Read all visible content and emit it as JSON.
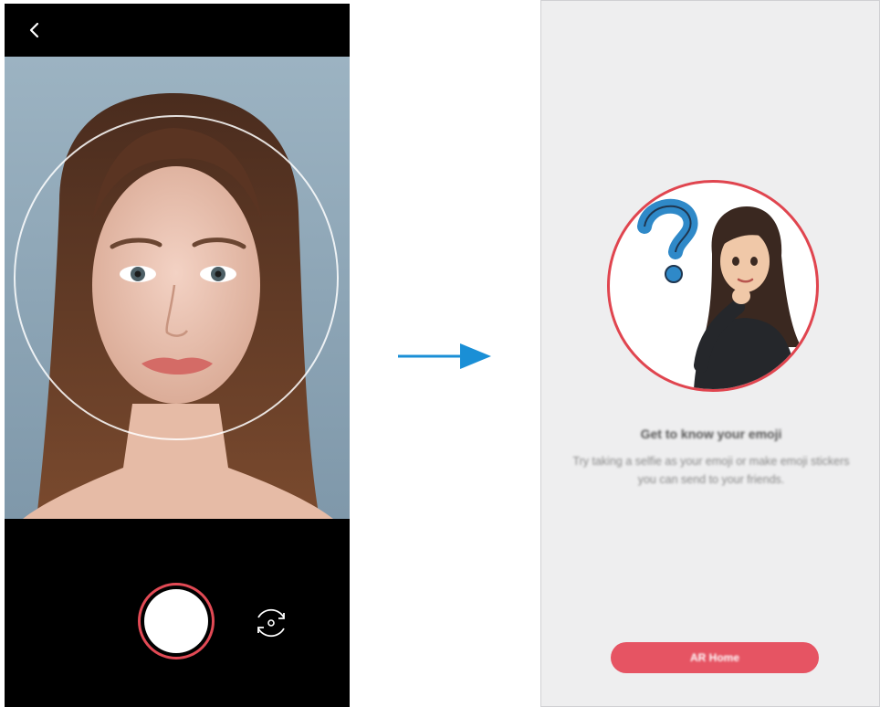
{
  "camera_screen": {
    "back_icon": "chevron-left-icon",
    "shutter_icon": "shutter-button",
    "switch_icon": "switch-camera-icon",
    "colors": {
      "shutter_ring": "#e24a55",
      "guide_circle": "#ffffff"
    }
  },
  "transition": {
    "arrow_color": "#1a8fd6"
  },
  "intro_screen": {
    "title": "Get to know your emoji",
    "description": "Try taking a selfie as your emoji or make emoji stickers you can send to your friends.",
    "button_label": "AR Home",
    "colors": {
      "accent": "#e65463",
      "ring": "#e0454f"
    }
  }
}
